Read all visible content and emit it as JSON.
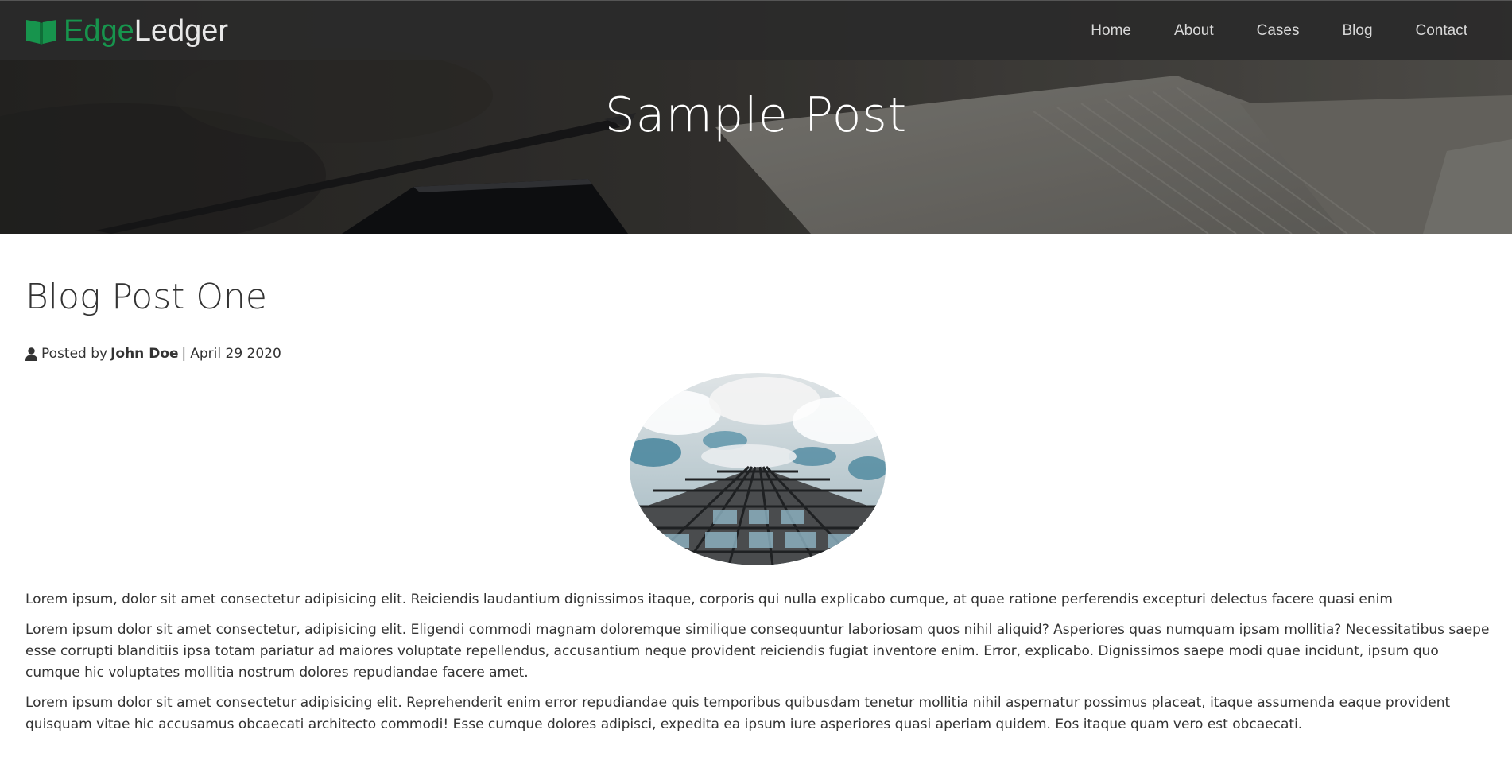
{
  "brand": {
    "edge": "Edge",
    "ledger": "Ledger",
    "icon": "open-book-icon",
    "accent_color": "#17944d"
  },
  "nav": {
    "items": [
      {
        "label": "Home"
      },
      {
        "label": "About"
      },
      {
        "label": "Cases"
      },
      {
        "label": "Blog"
      },
      {
        "label": "Contact"
      }
    ]
  },
  "hero": {
    "title": "Sample Post"
  },
  "post": {
    "title": "Blog Post One",
    "meta": {
      "icon": "user-icon",
      "posted_by": "Posted by",
      "author": "John Doe",
      "separator": "|",
      "date": "April 29 2020"
    },
    "paragraphs": [
      "Lorem ipsum, dolor sit amet consectetur adipisicing elit. Reiciendis laudantium dignissimos itaque, corporis qui nulla explicabo cumque, at quae ratione perferendis excepturi delectus facere quasi enim",
      "Lorem ipsum dolor sit amet consectetur, adipisicing elit. Eligendi commodi magnam doloremque similique consequuntur laboriosam quos nihil aliquid? Asperiores quas numquam ipsam mollitia? Necessitatibus saepe esse corrupti blanditiis ipsa totam pariatur ad maiores voluptate repellendus, accusantium neque provident reiciendis fugiat inventore enim. Error, explicabo. Dignissimos saepe modi quae incidunt, ipsum quo cumque hic voluptates mollitia nostrum dolores repudiandae facere amet.",
      "Lorem ipsum dolor sit amet consectetur adipisicing elit. Reprehenderit enim error repudiandae quis temporibus quibusdam tenetur mollitia nihil aspernatur possimus placeat, itaque assumenda eaque provident quisquam vitae hic accusamus obcaecati architecto commodi! Esse cumque dolores adipisci, expedita ea ipsum iure asperiores quasi aperiam quidem. Eos itaque quam vero est obcaecati."
    ]
  }
}
